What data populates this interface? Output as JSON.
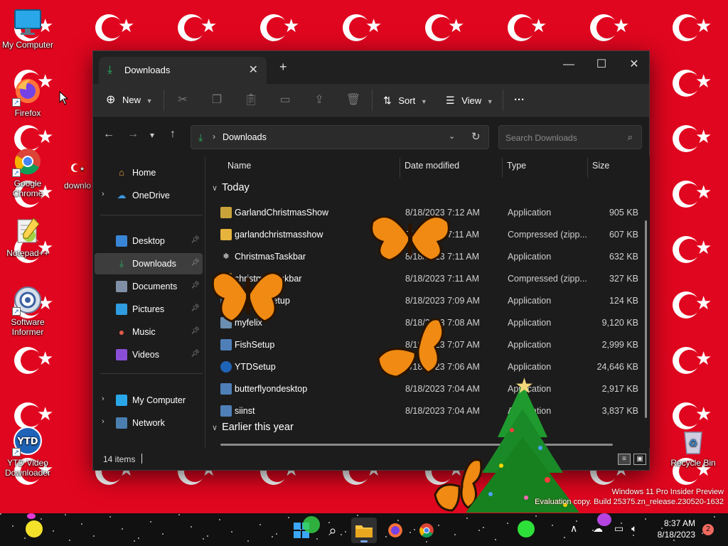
{
  "desktop": {
    "icons": [
      {
        "label": "My Computer",
        "icon": "monitor-icon"
      },
      {
        "label": "Firefox",
        "icon": "firefox-icon"
      },
      {
        "label": "Google Chrome",
        "icon": "chrome-icon"
      },
      {
        "label": "downlo",
        "icon": "flag-file-icon"
      },
      {
        "label": "Notepad++",
        "icon": "notepadpp-icon"
      },
      {
        "label": "Software Informer",
        "icon": "software-informer-icon"
      },
      {
        "label": "YTD Video Downloader",
        "icon": "ytd-icon"
      },
      {
        "label": "Recycle Bin",
        "icon": "recycle-bin-icon"
      }
    ],
    "watermark_line1": "Windows 11 Pro Insider Preview",
    "watermark_line2": "Evaluation copy. Build 25375.zn_release.230520-1632"
  },
  "explorer": {
    "tab_title": "Downloads",
    "toolbar": {
      "new_label": "New",
      "sort_label": "Sort",
      "view_label": "View",
      "more_label": "···"
    },
    "address": {
      "path": "Downloads",
      "separator": "›"
    },
    "search": {
      "placeholder": "Search Downloads"
    },
    "sidebar": {
      "home": "Home",
      "onedrive": "OneDrive",
      "desktop": "Desktop",
      "downloads": "Downloads",
      "documents": "Documents",
      "pictures": "Pictures",
      "music": "Music",
      "videos": "Videos",
      "my_computer": "My Computer",
      "network": "Network"
    },
    "columns": {
      "name": "Name",
      "date": "Date modified",
      "type": "Type",
      "size": "Size"
    },
    "groups": {
      "today": "Today",
      "earlier": "Earlier this year"
    },
    "files": [
      {
        "name": "GarlandChristmasShow",
        "date": "8/18/2023 7:12 AM",
        "type": "Application",
        "size": "905 KB",
        "icon": "garland-app-icon"
      },
      {
        "name": "garlandchristmasshow",
        "date": "8/18/2023 7:11 AM",
        "type": "Compressed (zipp...",
        "size": "607 KB",
        "icon": "zip-folder-icon"
      },
      {
        "name": "ChristmasTaskbar",
        "date": "8/18/2023 7:11 AM",
        "type": "Application",
        "size": "632 KB",
        "icon": "snowflake-app-icon"
      },
      {
        "name": "christmastaskbar",
        "date": "8/18/2023 7:11 AM",
        "type": "Compressed (zipp...",
        "size": "327 KB",
        "icon": "zip-folder-icon"
      },
      {
        "name": "DeskFlySetup",
        "date": "8/18/2023 7:09 AM",
        "type": "Application",
        "size": "124 KB",
        "icon": "setup-app-icon"
      },
      {
        "name": "myfelix",
        "date": "8/18/2023 7:08 AM",
        "type": "Application",
        "size": "9,120 KB",
        "icon": "image-app-icon"
      },
      {
        "name": "FishSetup",
        "date": "8/18/2023 7:07 AM",
        "type": "Application",
        "size": "2,999 KB",
        "icon": "setup-app-icon"
      },
      {
        "name": "YTDSetup",
        "date": "8/18/2023 7:06 AM",
        "type": "Application",
        "size": "24,646 KB",
        "icon": "ytd-app-icon"
      },
      {
        "name": "butterflyondesktop",
        "date": "8/18/2023 7:04 AM",
        "type": "Application",
        "size": "2,917 KB",
        "icon": "setup-app-icon"
      },
      {
        "name": "siinst",
        "date": "8/18/2023 7:04 AM",
        "type": "Application",
        "size": "3,837 KB",
        "icon": "setup-app-icon"
      }
    ],
    "status": {
      "item_count": "14 items"
    }
  },
  "taskbar": {
    "time": "8:37 AM",
    "date": "8/18/2023",
    "notification_count": "2",
    "apps": [
      "windows-start-icon",
      "search-icon",
      "file-explorer-icon",
      "firefox-icon",
      "chrome-icon"
    ]
  },
  "colors": {
    "accent_green": "#28b463",
    "wallpaper_red": "#e0061f",
    "window_bg": "#1c1c1c"
  }
}
